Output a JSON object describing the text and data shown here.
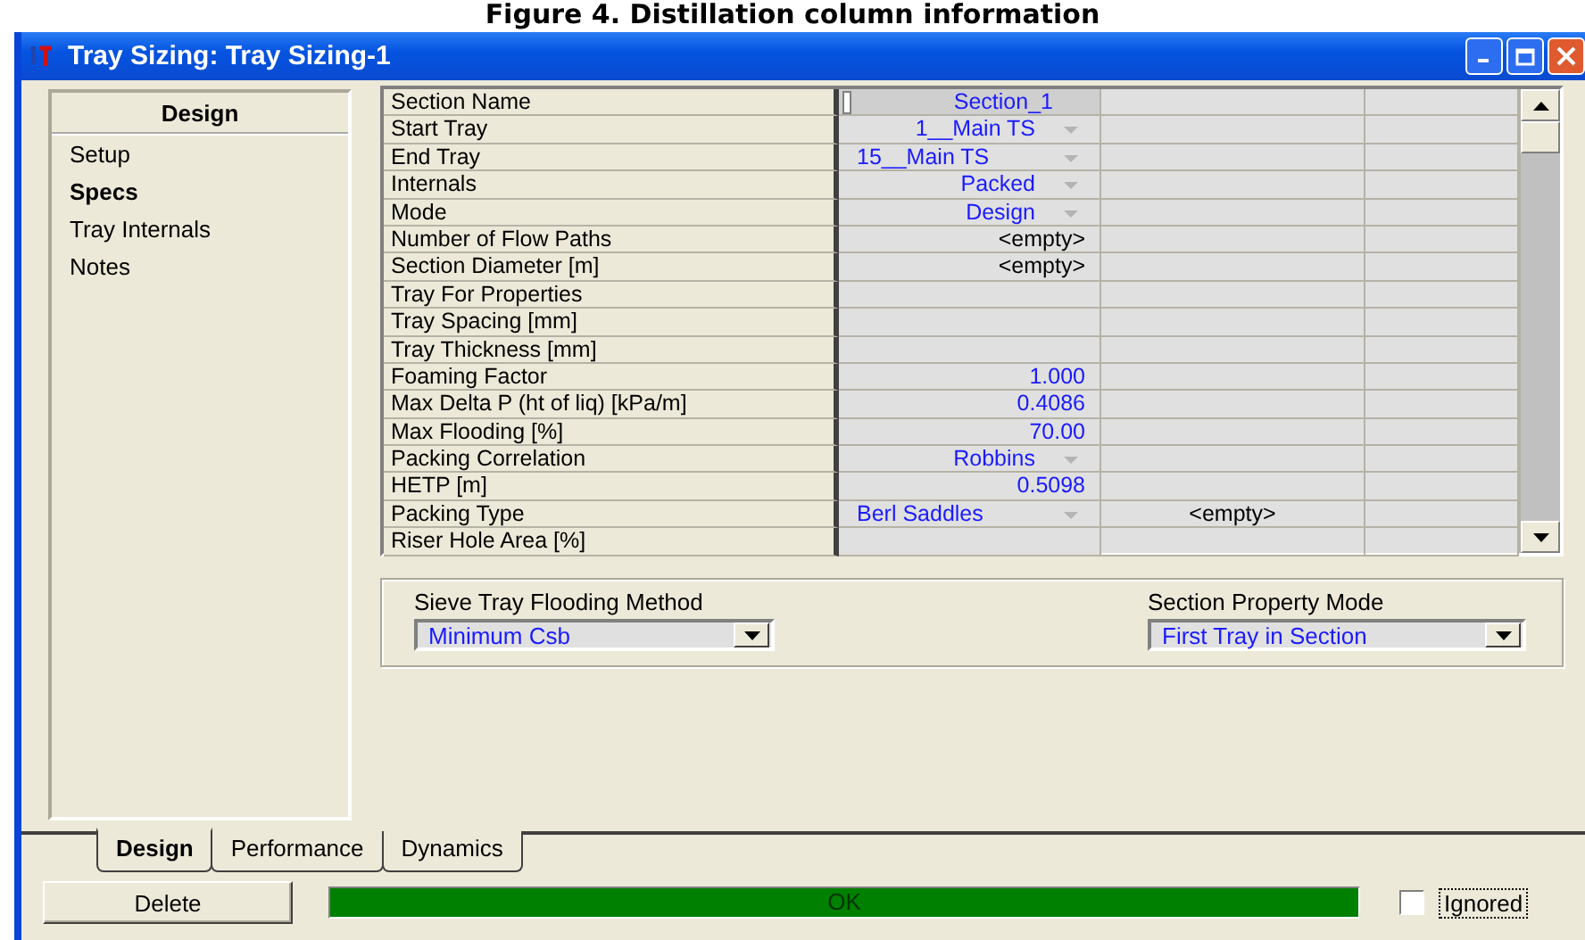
{
  "caption": "Figure 4. Distillation column information",
  "window": {
    "title": "Tray Sizing: Tray Sizing-1"
  },
  "sidebar": {
    "heading": "Design",
    "items": [
      {
        "label": "Setup",
        "selected": false
      },
      {
        "label": "Specs",
        "selected": true
      },
      {
        "label": "Tray Internals",
        "selected": false
      },
      {
        "label": "Notes",
        "selected": false
      }
    ]
  },
  "table": {
    "rows": [
      {
        "label": "Section Name",
        "value": "Section_1",
        "kind": "name",
        "selected": true
      },
      {
        "label": "Start Tray",
        "value": "1__Main TS",
        "kind": "list",
        "selected": false
      },
      {
        "label": "End Tray",
        "value": "15__Main TS",
        "kind": "list",
        "selected": false
      },
      {
        "label": "Internals",
        "value": "Packed",
        "kind": "list",
        "selected": false
      },
      {
        "label": "Mode",
        "value": "Design",
        "kind": "list",
        "selected": false
      },
      {
        "label": "Number of Flow Paths",
        "value": "<empty>",
        "kind": "empty",
        "selected": false
      },
      {
        "label": "Section Diameter [m]",
        "value": "<empty>",
        "kind": "empty",
        "selected": false
      },
      {
        "label": "Tray For Properties",
        "kind": "blank",
        "selected": false
      },
      {
        "label": "Tray Spacing [mm]",
        "kind": "blank",
        "selected": false
      },
      {
        "label": "Tray Thickness [mm]",
        "kind": "blank",
        "selected": false
      },
      {
        "label": "Foaming Factor",
        "value": "1.000",
        "kind": "number",
        "selected": false
      },
      {
        "label": "Max Delta P (ht of liq) [kPa/m]",
        "value": "0.4086",
        "kind": "number",
        "selected": false
      },
      {
        "label": "Max Flooding [%]",
        "value": "70.00",
        "kind": "number",
        "selected": false
      },
      {
        "label": "Packing Correlation",
        "value": "Robbins",
        "kind": "list",
        "selected": false
      },
      {
        "label": "HETP [m]",
        "value": "0.5098",
        "kind": "number",
        "selected": false
      },
      {
        "label": "Packing Type",
        "value": "Berl Saddles",
        "kind": "list",
        "column_2": "<empty>",
        "selected": false
      },
      {
        "label": "Riser Hole Area  [%]",
        "kind": "blank",
        "selected": false
      }
    ]
  },
  "options": [
    {
      "label": "Sieve Tray Flooding Method",
      "value": "Minimum Csb"
    },
    {
      "label": "Section Property Mode",
      "value": "First Tray in Section"
    }
  ],
  "tabs": [
    {
      "label": "Design",
      "selected": true
    },
    {
      "label": "Performance",
      "selected": false
    },
    {
      "label": "Dynamics",
      "selected": false
    }
  ],
  "footer": {
    "button": "Delete",
    "status": "OK",
    "ignored": {
      "label": "Ignored",
      "checked": false
    }
  }
}
